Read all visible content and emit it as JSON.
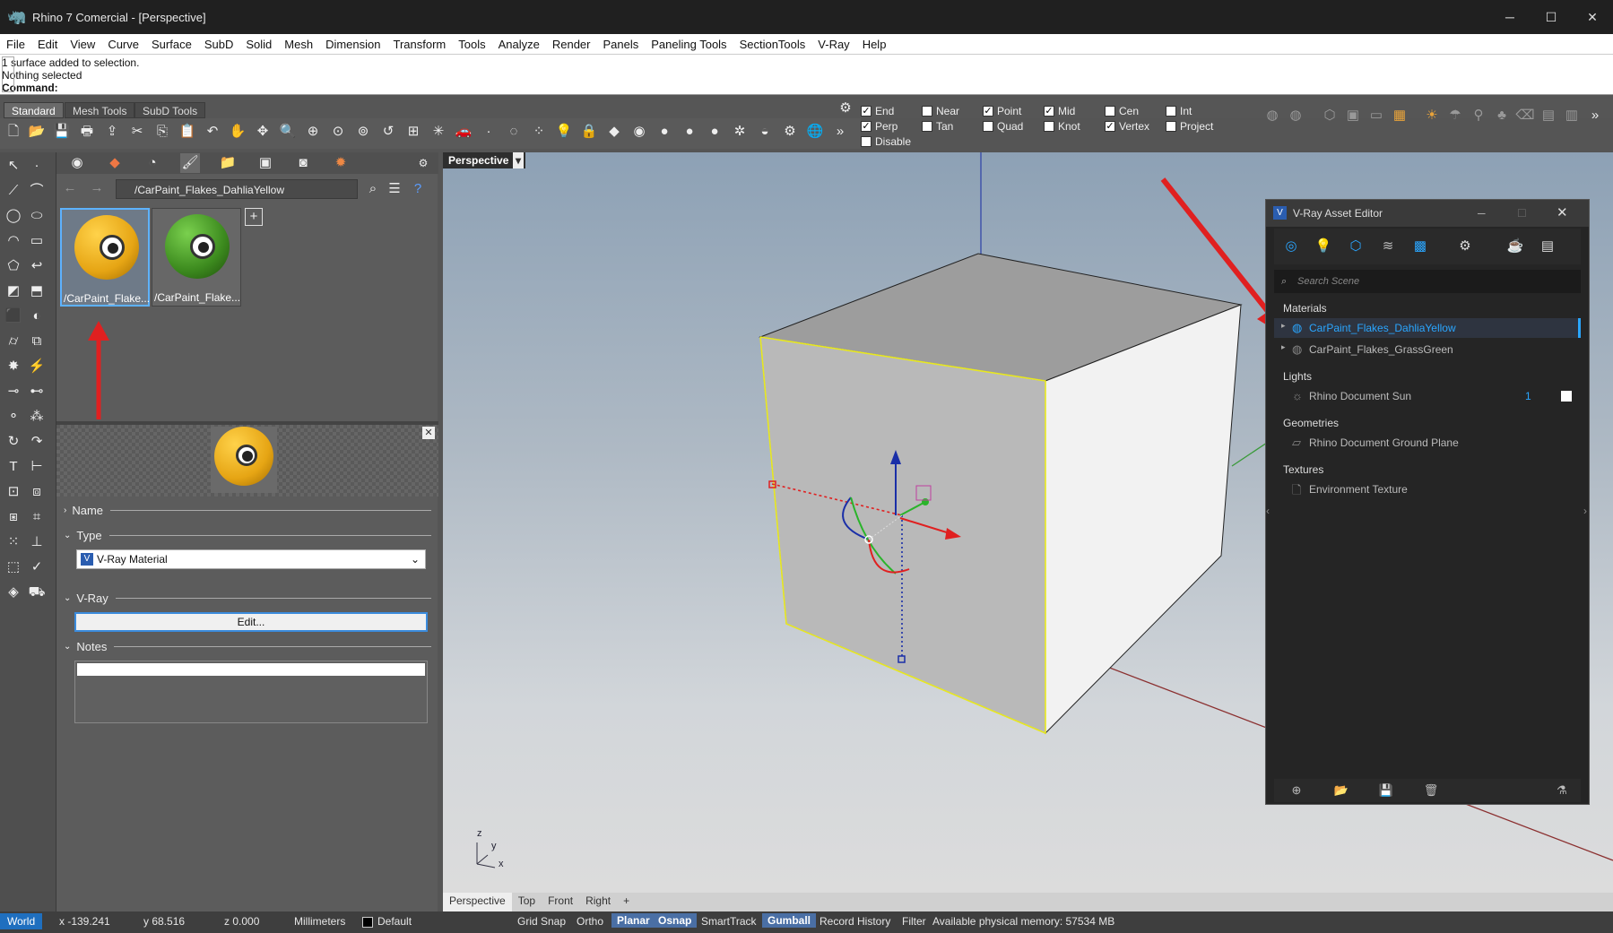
{
  "app": {
    "title": "Rhino 7 Comercial - [Perspective]"
  },
  "menu": [
    "File",
    "Edit",
    "View",
    "Curve",
    "Surface",
    "SubD",
    "Solid",
    "Mesh",
    "Dimension",
    "Transform",
    "Tools",
    "Analyze",
    "Render",
    "Panels",
    "Paneling Tools",
    "SectionTools",
    "V-Ray",
    "Help"
  ],
  "command": {
    "line1": "1 surface added to selection.",
    "line2": "Nothing selected",
    "prompt": "Command:"
  },
  "toolbar_tabs": [
    "Standard",
    "Mesh Tools",
    "SubD Tools"
  ],
  "osnaps": [
    {
      "label": "End",
      "checked": true
    },
    {
      "label": "Near",
      "checked": false
    },
    {
      "label": "Point",
      "checked": true
    },
    {
      "label": "Mid",
      "checked": true
    },
    {
      "label": "Cen",
      "checked": false
    },
    {
      "label": "Int",
      "checked": false
    },
    {
      "label": "Perp",
      "checked": true
    },
    {
      "label": "Tan",
      "checked": false
    },
    {
      "label": "Quad",
      "checked": false
    },
    {
      "label": "Knot",
      "checked": false
    },
    {
      "label": "Vertex",
      "checked": true
    },
    {
      "label": "Project",
      "checked": false
    },
    {
      "label": "Disable",
      "checked": false
    }
  ],
  "materials_panel": {
    "path": "/CarPaint_Flakes_DahliaYellow",
    "thumbs": [
      {
        "label": "/CarPaint_Flake...",
        "color": "#e6a514"
      },
      {
        "label": "/CarPaint_Flake...",
        "color": "#3c8a1e"
      }
    ],
    "sections": {
      "name": "Name",
      "type": "Type",
      "vray": "V-Ray",
      "notes": "Notes"
    },
    "type_value": "V-Ray Material",
    "edit_button": "Edit..."
  },
  "viewport": {
    "title": "Perspective",
    "tabs": [
      "Perspective",
      "Top",
      "Front",
      "Right",
      "+"
    ],
    "axis_z": "z",
    "axis_y": "y",
    "axis_x": "x"
  },
  "vray": {
    "title": "V-Ray Asset Editor",
    "search_placeholder": "Search Scene",
    "materials_label": "Materials",
    "materials": [
      "CarPaint_Flakes_DahliaYellow",
      "CarPaint_Flakes_GrassGreen"
    ],
    "lights_label": "Lights",
    "light": "Rhino Document Sun",
    "light_count": "1",
    "geometries_label": "Geometries",
    "geometry": "Rhino Document Ground Plane",
    "textures_label": "Textures",
    "texture": "Environment Texture"
  },
  "status": {
    "world": "World",
    "x": "x -139.241",
    "y": "y 68.516",
    "z": "z 0.000",
    "units": "Millimeters",
    "layer": "Default",
    "grid_snap": "Grid Snap",
    "ortho": "Ortho",
    "planar": "Planar",
    "osnap": "Osnap",
    "smarttrack": "SmartTrack",
    "gumball": "Gumball",
    "record": "Record History",
    "filter": "Filter",
    "memory": "Available physical memory: 57534 MB"
  }
}
